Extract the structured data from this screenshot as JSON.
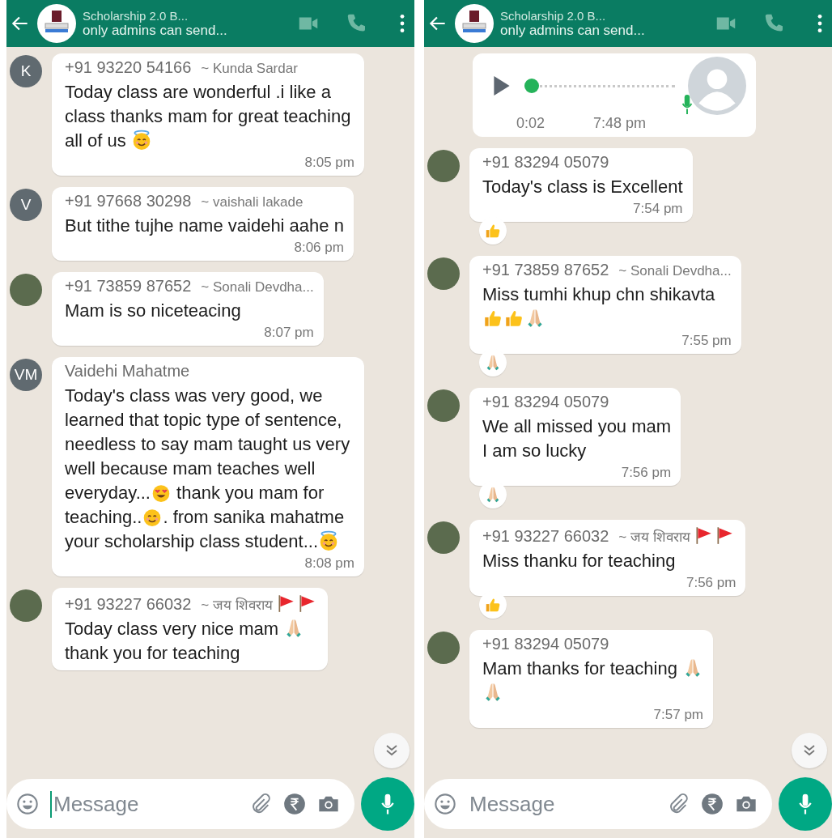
{
  "phones": [
    {
      "header": {
        "title": "Scholarship 2.0 B...",
        "subtitle": "only admins can send..."
      },
      "messages": [
        {
          "kind": "text",
          "avatar": {
            "kind": "letter",
            "text": "K"
          },
          "phone": "+91 93220 54166",
          "name": [
            {
              "kind": "text",
              "text": "~ Kunda Sardar"
            }
          ],
          "body": [
            {
              "kind": "text",
              "text": "Today class are wonderful .i like a class thanks mam for great teaching all of us "
            },
            {
              "kind": "halo"
            }
          ],
          "time": "8:05 pm"
        },
        {
          "kind": "text",
          "avatar": {
            "kind": "letter",
            "text": "V"
          },
          "phone": "+91 97668 30298",
          "name": [
            {
              "kind": "text",
              "text": "~ vaishali lakade"
            }
          ],
          "body": [
            {
              "kind": "text",
              "text": "But  tithe  tujhe name vaidehi aahe n"
            }
          ],
          "time": "8:06 pm"
        },
        {
          "kind": "text",
          "avatar": {
            "kind": "photo"
          },
          "phone": "+91 73859 87652",
          "name": [
            {
              "kind": "text",
              "text": "~ Sonali Devdha..."
            }
          ],
          "body": [
            {
              "kind": "text",
              "text": "Mam is so niceteacing"
            }
          ],
          "time": "8:07 pm"
        },
        {
          "kind": "text",
          "avatar": {
            "kind": "letter",
            "text": "VM"
          },
          "phone": "Vaidehi Mahatme",
          "body": [
            {
              "kind": "text",
              "text": "Today's class was very good, we learned that topic type of sentence, needless to say mam taught us very well because mam teaches well everyday..."
            },
            {
              "kind": "heart-eyes"
            },
            {
              "kind": "text",
              "text": " thank you mam for teaching.."
            },
            {
              "kind": "smile"
            },
            {
              "kind": "text",
              "text": ".  from sanika mahatme your scholarship class student..."
            },
            {
              "kind": "halo"
            }
          ],
          "time": "8:08 pm"
        },
        {
          "kind": "text",
          "avatar": {
            "kind": "photo"
          },
          "phone": "+91 93227 66032",
          "name": [
            {
              "kind": "text",
              "text": "~ जय शिवराय "
            },
            {
              "kind": "flag"
            },
            {
              "kind": "flag"
            }
          ],
          "body": [
            {
              "kind": "text",
              "text": "Today class very nice mam "
            },
            {
              "kind": "pray"
            },
            {
              "kind": "br"
            },
            {
              "kind": "text",
              "text": "thank you for teaching"
            }
          ]
        }
      ],
      "composer": {
        "placeholder": "Message",
        "focused": true
      }
    },
    {
      "header": {
        "title": "Scholarship 2.0 B...",
        "subtitle": "only admins can send..."
      },
      "messages": [
        {
          "kind": "voice",
          "duration": "0:02",
          "time": "7:48 pm",
          "level": 0
        },
        {
          "kind": "text",
          "avatar": {
            "kind": "photo"
          },
          "phone": "+91 83294 05079",
          "body": [
            {
              "kind": "text",
              "text": "Today's class is Excellent"
            }
          ],
          "time": "7:54 pm",
          "reaction": {
            "kind": "thumbs"
          }
        },
        {
          "kind": "text",
          "avatar": {
            "kind": "photo"
          },
          "phone": "+91 73859 87652",
          "name": [
            {
              "kind": "text",
              "text": "~ Sonali Devdha..."
            }
          ],
          "body": [
            {
              "kind": "text",
              "text": "Miss tumhi khup chn shikavta"
            },
            {
              "kind": "br"
            },
            {
              "kind": "thumbs"
            },
            {
              "kind": "thumbs"
            },
            {
              "kind": "pray"
            }
          ],
          "time": "7:55 pm",
          "reaction": {
            "kind": "pray"
          }
        },
        {
          "kind": "text",
          "avatar": {
            "kind": "photo"
          },
          "phone": "+91 83294 05079",
          "body": [
            {
              "kind": "text",
              "text": "We all missed you mam"
            },
            {
              "kind": "br"
            },
            {
              "kind": "text",
              "text": "I am so lucky"
            }
          ],
          "time": "7:56 pm",
          "reaction": {
            "kind": "pray"
          }
        },
        {
          "kind": "text",
          "avatar": {
            "kind": "photo"
          },
          "phone": "+91 93227 66032",
          "name": [
            {
              "kind": "text",
              "text": "~ जय शिवराय "
            },
            {
              "kind": "flag"
            },
            {
              "kind": "flag"
            }
          ],
          "body": [
            {
              "kind": "text",
              "text": "Miss thanku for teaching"
            },
            {
              "kind": "br"
            }
          ],
          "time": "7:56 pm",
          "reaction": {
            "kind": "thumbs"
          }
        },
        {
          "kind": "text",
          "avatar": {
            "kind": "photo"
          },
          "phone": "+91 83294 05079",
          "body": [
            {
              "kind": "text",
              "text": "Mam thanks for teaching "
            },
            {
              "kind": "pray"
            },
            {
              "kind": "br"
            },
            {
              "kind": "pray"
            }
          ],
          "time": "7:57 pm"
        }
      ],
      "composer": {
        "placeholder": "Message",
        "focused": false
      }
    }
  ]
}
